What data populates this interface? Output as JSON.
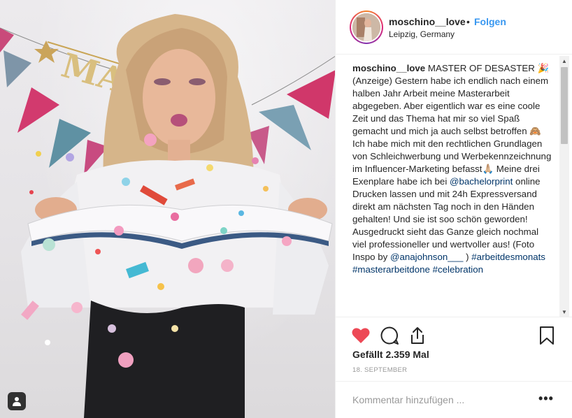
{
  "post": {
    "username": "moschino__love",
    "separator": "•",
    "follow_label": "Folgen",
    "location": "Leipzig, Germany",
    "banner_text": "MAST"
  },
  "caption": {
    "username": "moschino__love",
    "part1": " MASTER OF DESASTER 🎉 (Anzeige) Gestern habe ich endlich nach einem halben Jahr Arbeit meine Masterarbeit abgegeben. Aber eigentlich war es eine coole Zeit und das Thema hat mir so viel Spaß gemacht und mich ja auch selbst betroffen 🙈 Ich habe mich mit den rechtlichen Grundlagen von Schleichwerbung und Werbekennzeichnung im Influencer-Marketing befasst🙏🏼 Meine drei Exenplare habe ich bei ",
    "mention1": "@bachelorprint",
    "part2": " online Drucken lassen und mit 24h Expressversand direkt am nächsten Tag noch in den Händen gehalten! Und sie ist soo schön geworden! Ausgedruckt sieht das Ganze gleich nochmal viel professioneller und wertvoller aus! (Foto Inspo by ",
    "mention2": "@anajohnson___",
    "part3": " ) ",
    "tag1": "#arbeitdesmonats",
    "tag2": "#masterarbeitdone",
    "tag3": "#celebration"
  },
  "actions": {
    "like_icon": "heart-icon",
    "comment_icon": "comment-icon",
    "share_icon": "share-icon",
    "save_icon": "bookmark-icon",
    "like_color": "#ed4956"
  },
  "likes_text": "Gefällt 2.359 Mal",
  "date": "18. SEPTEMBER",
  "comment": {
    "placeholder": "Kommentar hinzufügen ...",
    "more_label": "•••"
  },
  "colors": {
    "follow": "#3897f0",
    "link": "#003569",
    "meta": "#999999"
  }
}
